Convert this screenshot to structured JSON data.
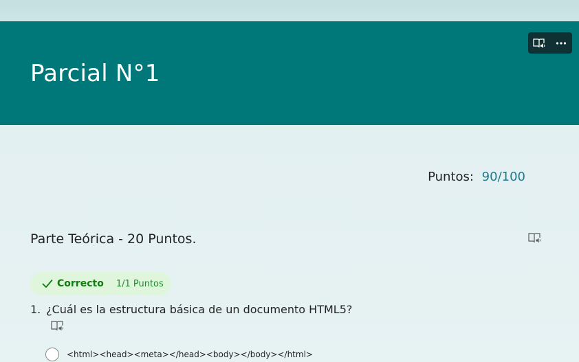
{
  "header": {
    "title": "Parcial N°1",
    "toolbar": {
      "reader_icon": "immersive-reader-icon",
      "more_icon": "more-options-icon"
    }
  },
  "summary": {
    "points_label": "Puntos:",
    "points_value": "90/100"
  },
  "section": {
    "title": "Parte Teórica - 20 Puntos.",
    "reader_icon": "immersive-reader-icon"
  },
  "question": {
    "number": "1.",
    "status": "Correcto",
    "score": "1/1 Puntos",
    "text": "¿Cuál es la estructura básica de un documento HTML5?",
    "options": [
      {
        "label": "<html><head><meta></head><body></body></html>",
        "selected": false
      }
    ]
  },
  "colors": {
    "header_bg": "#00787a",
    "points_value": "#1f7a8c",
    "correct_badge_bg": "#dff6dd",
    "correct_text": "#107c10"
  }
}
